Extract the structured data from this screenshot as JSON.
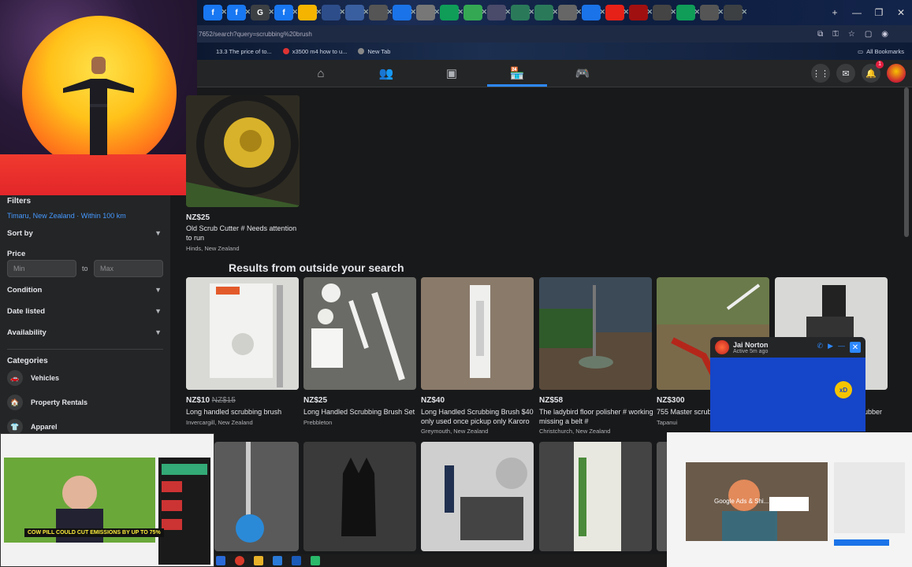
{
  "browser": {
    "url": "7652/search?query=scrubbing%20brush",
    "bookmarks": [
      "13.3 The price of to...",
      "x3500 m4 how to u...",
      "New Tab"
    ],
    "all_bookmarks": "All Bookmarks",
    "tab_letters": [
      "f",
      "f",
      "G",
      "f"
    ],
    "window_controls": {
      "minimize": "—",
      "restore": "❐",
      "close": "✕"
    }
  },
  "fbnav": {
    "notification_count": "1"
  },
  "sidebar": {
    "filters_label": "Filters",
    "location": "Timaru, New Zealand · Within 100 km",
    "sort_by": "Sort by",
    "price_label": "Price",
    "min_placeholder": "Min",
    "to": "to",
    "max_placeholder": "Max",
    "condition": "Condition",
    "date_listed": "Date listed",
    "availability": "Availability",
    "categories_label": "Categories",
    "categories": [
      "Vehicles",
      "Property Rentals",
      "Apparel"
    ]
  },
  "top_listing": {
    "price": "NZ$25",
    "title": "Old Scrub Cutter # Needs attention to run",
    "location": "Hinds, New Zealand"
  },
  "results_heading": "Results from outside your search",
  "listings": [
    {
      "price": "NZ$10",
      "old_price": "NZ$15",
      "title": "Long handled scrubbing brush",
      "location": "Invercargill, New Zealand"
    },
    {
      "price": "NZ$25",
      "old_price": "",
      "title": "Long Handled Scrubbing Brush Set",
      "location": "Prebbleton"
    },
    {
      "price": "NZ$40",
      "old_price": "",
      "title": "Long Handled Scrubbing Brush $40 only used once pickup only Karoro",
      "location": "Greymouth, New Zealand"
    },
    {
      "price": "NZ$58",
      "old_price": "",
      "title": "The ladybird floor polisher # working missing a belt #",
      "location": "Christchurch, New Zealand"
    },
    {
      "price": "NZ$300",
      "old_price": "",
      "title": "755 Master scrub",
      "location": "Tapanui"
    },
    {
      "price": "",
      "old_price": "",
      "title": "ubber",
      "location": ""
    }
  ],
  "chat": {
    "name": "Jai Norton",
    "status": "Active 5m ago",
    "bubble": "xD"
  },
  "video_left": {
    "caption": "COW PILL COULD CUT EMISSIONS BY UP TO 75%"
  },
  "video_right": {
    "ad_text": "Google Ads & Shi..."
  },
  "colors": {
    "accent": "#2d88ff",
    "bg": "#18191a",
    "panel": "#242526"
  }
}
